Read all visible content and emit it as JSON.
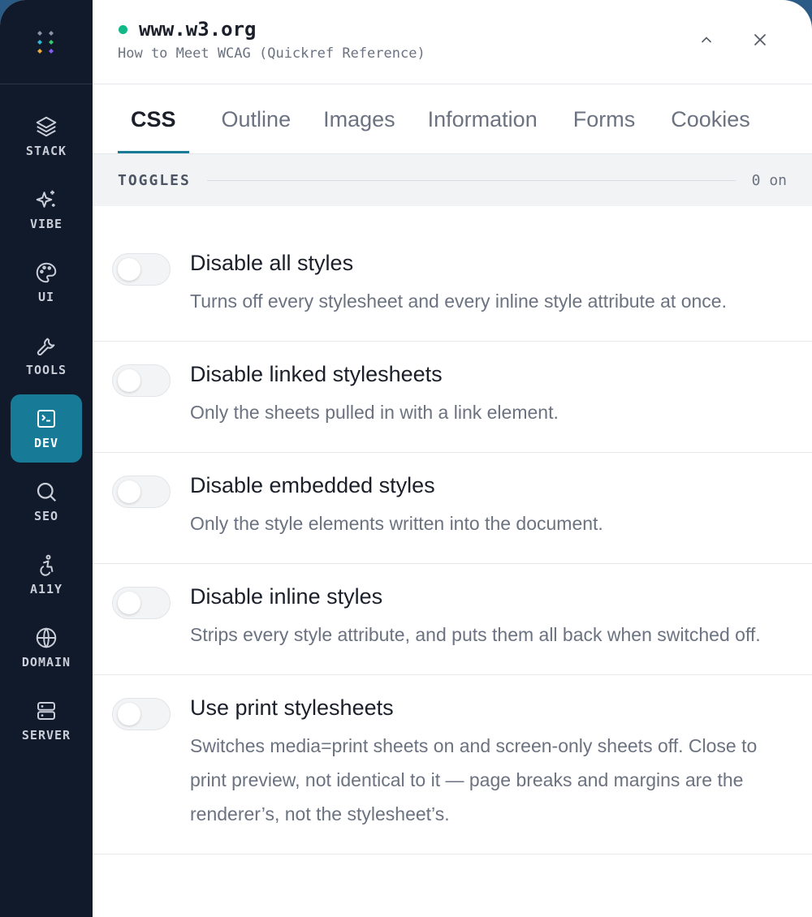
{
  "sidebar": {
    "items": [
      {
        "label": "STACK",
        "icon": "layers-icon",
        "active": false
      },
      {
        "label": "VIBE",
        "icon": "sparkles-icon",
        "active": false
      },
      {
        "label": "UI",
        "icon": "palette-icon",
        "active": false
      },
      {
        "label": "TOOLS",
        "icon": "wrench-icon",
        "active": false
      },
      {
        "label": "DEV",
        "icon": "terminal-icon",
        "active": true
      },
      {
        "label": "SEO",
        "icon": "search-icon",
        "active": false
      },
      {
        "label": "A11Y",
        "icon": "accessibility-icon",
        "active": false
      },
      {
        "label": "DOMAIN",
        "icon": "globe-icon",
        "active": false
      },
      {
        "label": "SERVER",
        "icon": "server-icon",
        "active": false
      }
    ]
  },
  "header": {
    "domain": "www.w3.org",
    "page_title": "How to Meet WCAG (Quickref Reference)",
    "status_color": "#12b886"
  },
  "tabs": [
    {
      "label": "CSS",
      "active": true
    },
    {
      "label": "Outline",
      "active": false
    },
    {
      "label": "Images",
      "active": false
    },
    {
      "label": "Information",
      "active": false
    },
    {
      "label": "Forms",
      "active": false
    },
    {
      "label": "Cookies",
      "active": false
    }
  ],
  "section": {
    "title": "TOGGLES",
    "count": "0 on"
  },
  "toggles": [
    {
      "title": "Disable all styles",
      "description": "Turns off every stylesheet and every inline style attribute at once.",
      "on": false
    },
    {
      "title": "Disable linked stylesheets",
      "description": "Only the sheets pulled in with a link element.",
      "on": false
    },
    {
      "title": "Disable embedded styles",
      "description": "Only the style elements written into the document.",
      "on": false
    },
    {
      "title": "Disable inline styles",
      "description": "Strips every style attribute, and puts them all back when switched off.",
      "on": false
    },
    {
      "title": "Use print stylesheets",
      "description": "Switches media=print sheets on and screen-only sheets off. Close to print preview, not identical to it — page breaks and margins are the renderer’s, not the stylesheet’s.",
      "on": false
    }
  ],
  "colors": {
    "accent": "#177a97",
    "sidebar_bg": "#111a2b"
  }
}
